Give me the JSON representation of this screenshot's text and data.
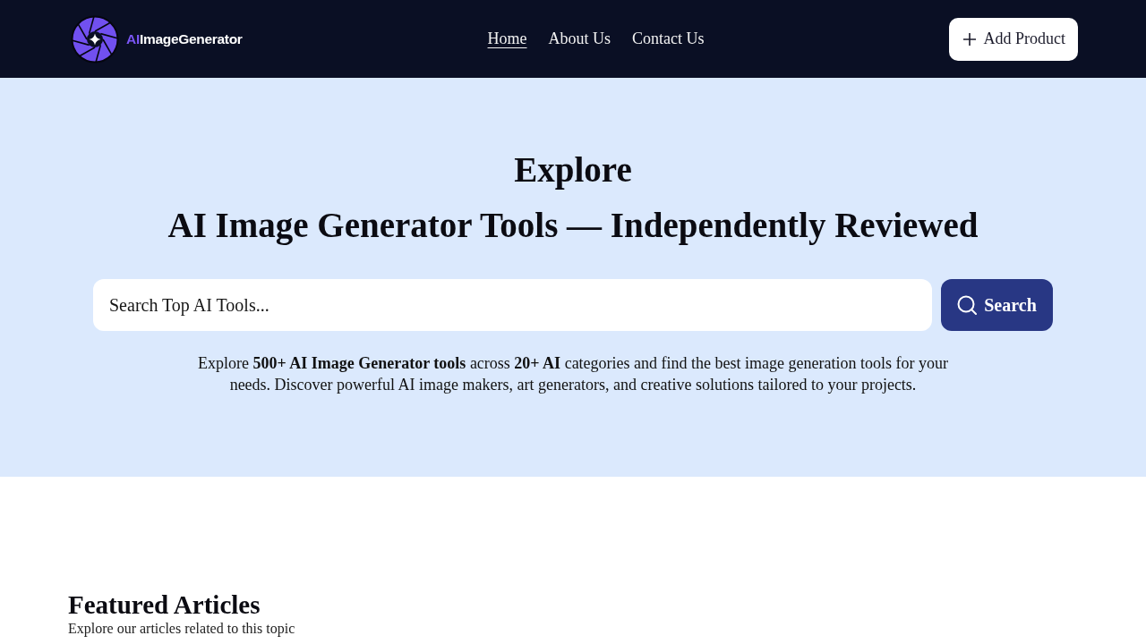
{
  "header": {
    "logo": {
      "accent": "AI",
      "name": "ImageGenerator"
    },
    "nav": [
      {
        "label": "Home",
        "selected": true
      },
      {
        "label": "About Us",
        "selected": false
      },
      {
        "label": "Contact Us",
        "selected": false
      }
    ],
    "action_button": {
      "label": "Add Product"
    }
  },
  "hero": {
    "title": "Explore",
    "subtitle": "AI Image Generator Tools — Independently Reviewed",
    "search": {
      "placeholder": "Search Top AI Tools...",
      "button": "Search"
    },
    "description": "Explore **500+ AI Image Generator tools** across **20+ AI** categories and find the best image generation tools for your needs. Discover powerful AI image makers, art generators, and creative solutions tailored to your projects."
  },
  "featured": {
    "title": "Featured Articles",
    "subtitle": "Explore our articles related to this topic"
  }
}
